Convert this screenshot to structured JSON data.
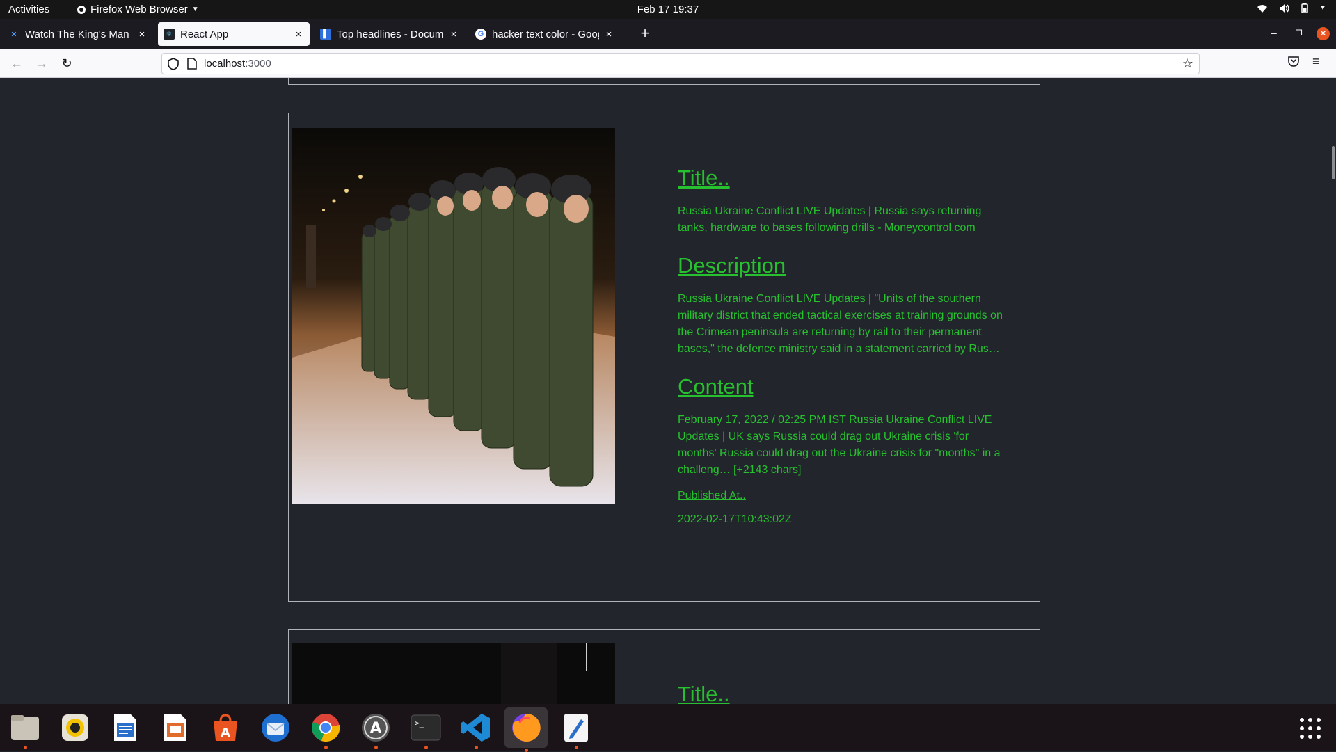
{
  "system_bar": {
    "activities": "Activities",
    "app_name": "Firefox Web Browser",
    "clock": "Feb 17  19:37"
  },
  "tabs": [
    {
      "label": "Watch The King's Man Fu",
      "icon": "tab-favicon-x"
    },
    {
      "label": "React App",
      "icon": "react-icon",
      "active": true
    },
    {
      "label": "Top headlines - Documen",
      "icon": "docs-icon"
    },
    {
      "label": "hacker text color - Google",
      "icon": "google-icon"
    }
  ],
  "navbar": {
    "url_host": "localhost",
    "url_port": ":3000"
  },
  "article": {
    "title_heading": "Title..",
    "title_text": "Russia Ukraine Conflict LIVE Updates | Russia says returning tanks, hardware to bases following drills - Moneycontrol.com",
    "description_heading": "Description",
    "description_text": "Russia Ukraine Conflict LIVE Updates | \"Units of the southern military district that ended tactical exercises at training grounds on the Crimean peninsula are returning by rail to their permanent bases,\" the defence ministry said in a statement carried by Rus…",
    "content_heading": "Content",
    "content_text": "February 17, 2022 / 02:25 PM IST Russia Ukraine Conflict LIVE Updates | UK says Russia could drag out Ukraine crisis 'for months' Russia could drag out the Ukraine crisis for \"months\" in a challeng… [+2143 chars]",
    "published_heading": "Published At..",
    "published_value": "2022-02-17T10:43:02Z"
  },
  "next_article": {
    "title_heading": "Title.."
  },
  "dock": [
    "files-icon",
    "rhythmbox-icon",
    "writer-icon",
    "impress-icon",
    "software-icon",
    "thunderbird-icon",
    "chrome-icon",
    "updater-icon",
    "terminal-icon",
    "vscode-icon",
    "firefox-icon",
    "text-editor-icon"
  ],
  "colors": {
    "accent_green": "#27c02e",
    "page_bg": "#22262c",
    "ubuntu_orange": "#e95420"
  }
}
